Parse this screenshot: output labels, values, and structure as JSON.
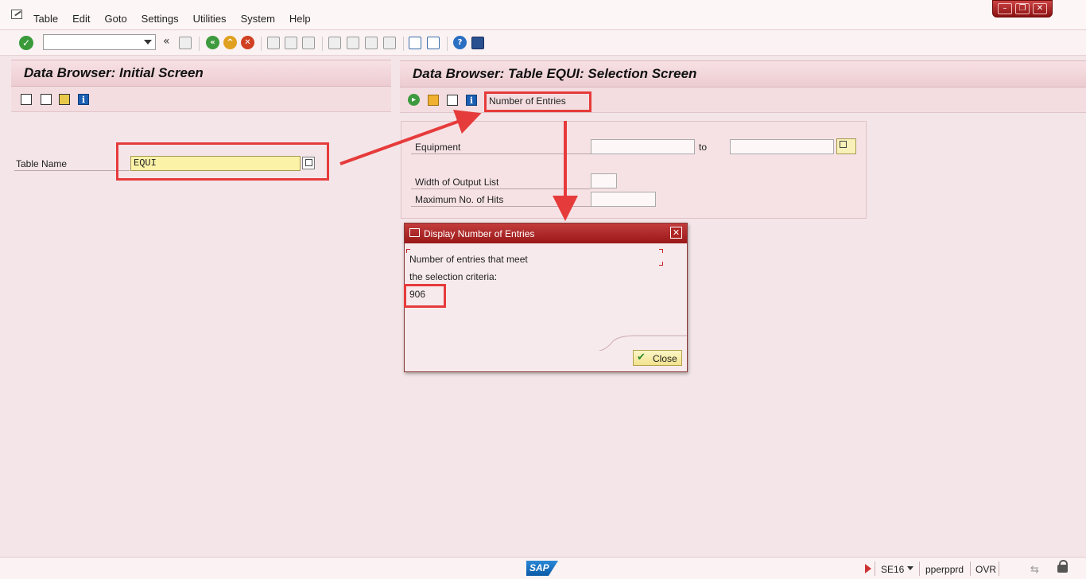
{
  "menu": {
    "items": [
      "Table",
      "Edit",
      "Goto",
      "Settings",
      "Utilities",
      "System",
      "Help"
    ]
  },
  "window_controls": {
    "minimize": "–",
    "restore": "❐",
    "close": "✕"
  },
  "toolbar": {
    "command_field_value": ""
  },
  "left_panel": {
    "title": "Data Browser: Initial Screen",
    "table_name_label": "Table Name",
    "table_name_value": "EQUI"
  },
  "right_panel": {
    "title": "Data Browser: Table EQUI: Selection Screen",
    "number_of_entries_label": "Number of Entries",
    "fields": {
      "equipment_label": "Equipment",
      "to_label": "to",
      "width_label": "Width of Output List",
      "max_hits_label": "Maximum No. of Hits"
    }
  },
  "dialog": {
    "title": "Display Number of Entries",
    "line1": "Number of entries that meet",
    "line2": "the selection criteria:",
    "count": "906",
    "close_label": "Close"
  },
  "status_bar": {
    "logo_text": "SAP",
    "transaction": "SE16",
    "server": "pperpprd",
    "mode": "OVR"
  },
  "colors": {
    "highlight_red": "#e63b3b",
    "dialog_title": "#9a1818",
    "field_yellow": "#fbf2a8",
    "background": "#f4e6e8"
  },
  "icons": {
    "toolbar": [
      "check-icon",
      "back-icon",
      "exit-icon",
      "cancel-icon",
      "print-icon",
      "find-icon",
      "help-icon",
      "layout-icon"
    ],
    "left_panel_toolbar": [
      "table-contents-icon",
      "new-entries-icon",
      "display-fields-icon",
      "info-icon"
    ],
    "right_panel_toolbar": [
      "execute-icon",
      "selection-options-icon",
      "delete-selection-icon",
      "info-icon"
    ]
  }
}
